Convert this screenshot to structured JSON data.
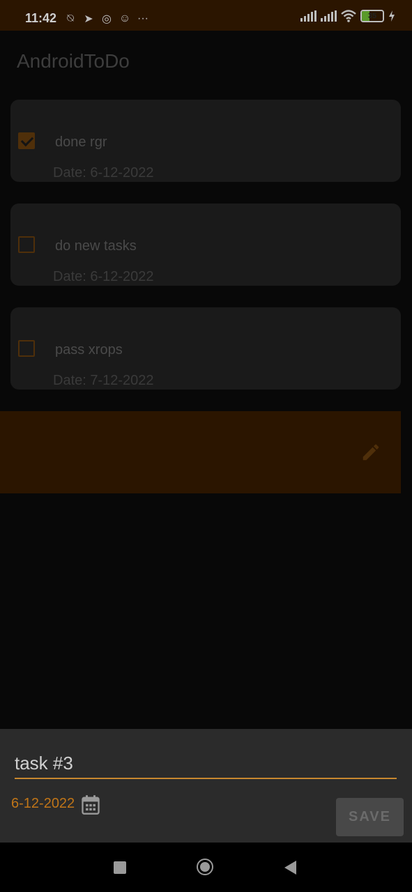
{
  "status_bar": {
    "time": "11:42",
    "battery": "35",
    "battery_level_percent": 35,
    "icons": [
      "bell-off-icon",
      "telegram-icon",
      "sync-icon",
      "avatar-icon",
      "more-icon",
      "signal-icon",
      "signal-icon",
      "wifi-icon",
      "battery-icon",
      "charging-icon"
    ]
  },
  "app": {
    "title": "AndroidToDo"
  },
  "tasks": [
    {
      "title": "done rgr",
      "date": "Date: 6-12-2022",
      "checked": true
    },
    {
      "title": "do new tasks",
      "date": "Date: 6-12-2022",
      "checked": false
    },
    {
      "title": "pass xrops",
      "date": "Date: 7-12-2022",
      "checked": false
    }
  ],
  "swipe_row": {
    "icon": "edit-icon"
  },
  "bottom_sheet": {
    "task_input_value": "task #3",
    "date": "6-12-2022",
    "calendar_icon": "calendar-icon",
    "save_label": "SAVE"
  },
  "nav_bar": {
    "icons": [
      "recent-apps-icon",
      "home-icon",
      "back-icon"
    ]
  },
  "colors": {
    "accent": "#c07518",
    "status_bar": "#2b1500",
    "card": "#1a1a1a",
    "sheet": "#2b2b2b"
  }
}
